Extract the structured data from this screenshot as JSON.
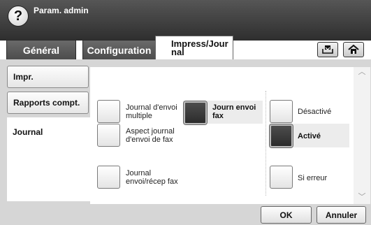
{
  "header": {
    "title": "Param. admin",
    "help_glyph": "?"
  },
  "tabs": {
    "general": "Général",
    "configuration": "Configuration",
    "active_line1": "Impress/Jour",
    "active_line2": "nal"
  },
  "icons": {
    "help": "help-icon",
    "tray": "tray-icon",
    "home": "home-icon"
  },
  "sidebar": {
    "items": [
      {
        "label": "Impr."
      },
      {
        "label": "Rapports compt."
      },
      {
        "label": "Journal"
      }
    ]
  },
  "options_left": [
    {
      "line1": "Journal d'envoi",
      "line2": "multiple"
    },
    {
      "line1": "Aspect journal",
      "line2": "d'envoi de fax"
    },
    {
      "line1": "Journal",
      "line2": "envoi/récep fax"
    }
  ],
  "selected_option": {
    "line1": "Journ envoi",
    "line2": "fax"
  },
  "options_right": [
    {
      "label": "Désactivé",
      "selected": false
    },
    {
      "label": "Activé",
      "selected": true
    },
    {
      "label": "Si erreur",
      "selected": false
    }
  ],
  "scroll": {
    "up": "︿",
    "down": "﹀"
  },
  "buttons": {
    "ok": "OK",
    "cancel": "Annuler"
  }
}
